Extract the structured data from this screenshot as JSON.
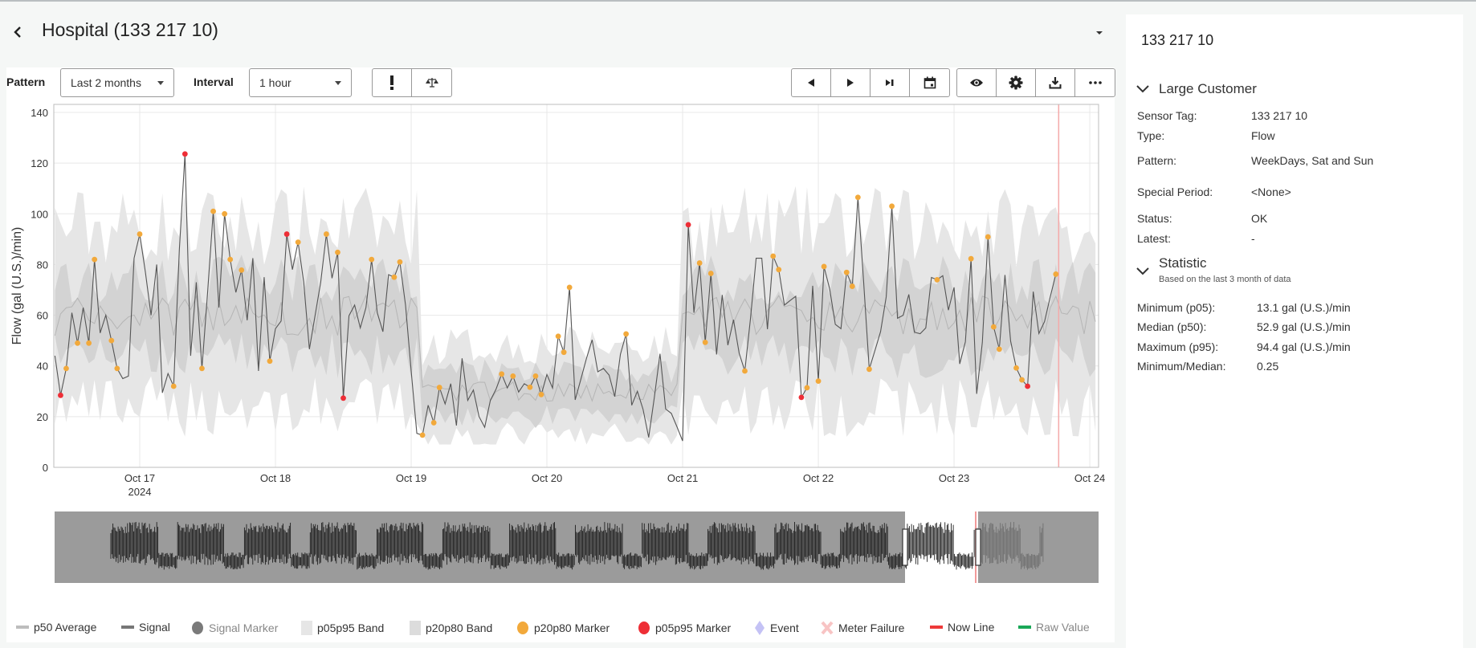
{
  "header": {
    "title": "Hospital (133 217 10)",
    "back_icon": "chevron-left-icon"
  },
  "toolbar": {
    "pattern_label": "Pattern",
    "pattern_value": "Last 2 months",
    "interval_label": "Interval",
    "interval_value": "1 hour",
    "buttons_left": [
      "exclamation-icon",
      "scale-icon"
    ],
    "nav_buttons": [
      "previous-icon",
      "play-icon",
      "skip-end-icon",
      "calendar-icon"
    ],
    "view_buttons": [
      "eye-icon",
      "gear-icon",
      "download-icon",
      "more-icon"
    ]
  },
  "legend": [
    {
      "label": "p50 Average",
      "color": "#bdbdbd",
      "shape": "line",
      "muted": false
    },
    {
      "label": "Signal",
      "color": "#777777",
      "shape": "line",
      "muted": false
    },
    {
      "label": "Signal Marker",
      "color": "#7a7a7a",
      "shape": "circle",
      "muted": true
    },
    {
      "label": "p05p95 Band",
      "color": "#e6e6e6",
      "shape": "square",
      "muted": false
    },
    {
      "label": "p20p80 Band",
      "color": "#dcdcdc",
      "shape": "square",
      "muted": false
    },
    {
      "label": "p20p80 Marker",
      "color": "#f2a93b",
      "shape": "circle",
      "muted": false
    },
    {
      "label": "p05p95 Marker",
      "color": "#ee2e36",
      "shape": "circle",
      "muted": false
    },
    {
      "label": "Event",
      "color": "#c4c2f5",
      "shape": "diamond",
      "muted": false
    },
    {
      "label": "Meter Failure",
      "color": "#f8c4c4",
      "shape": "cross",
      "muted": false
    },
    {
      "label": "Now Line",
      "color": "#ee3a3a",
      "shape": "line",
      "muted": false
    },
    {
      "label": "Raw Value",
      "color": "#1aa858",
      "shape": "line",
      "muted": true
    }
  ],
  "panel": {
    "title": "133 217 10",
    "section_title": "Large Customer",
    "fields": [
      {
        "label": "Sensor Tag:",
        "value": "133 217 10"
      },
      {
        "label": "Type:",
        "value": "Flow"
      },
      {
        "label": "Pattern:",
        "value": "WeekDays, Sat and Sun"
      },
      {
        "label": "Special Period:",
        "value": "<None>"
      },
      {
        "label": "Status:",
        "value": "OK"
      },
      {
        "label": "Latest:",
        "value": "-"
      }
    ],
    "statistic_title": "Statistic",
    "statistic_subtitle": "Based on the last 3 month of data",
    "stats": [
      {
        "label": "Minimum (p05):",
        "value": "13.1 gal (U.S.)/min"
      },
      {
        "label": "Median (p50):",
        "value": "52.9 gal (U.S.)/min"
      },
      {
        "label": "Maximum (p95):",
        "value": "94.4 gal (U.S.)/min"
      },
      {
        "label": "Minimum/Median:",
        "value": "0.25"
      }
    ]
  },
  "chart_data": {
    "type": "line",
    "ylabel": "Flow (gal (U.S.)/min)",
    "ylim": [
      0,
      140
    ],
    "yticks": [
      0,
      20,
      40,
      60,
      80,
      100,
      120,
      140
    ],
    "xlim": [
      "2024-10-16 09:00",
      "2024-10-24 01:00"
    ],
    "xticks": [
      {
        "date": "2024-10-17",
        "label": "Oct 17",
        "sublabel": "2024"
      },
      {
        "date": "2024-10-18",
        "label": "Oct 18"
      },
      {
        "date": "2024-10-19",
        "label": "Oct 19"
      },
      {
        "date": "2024-10-20",
        "label": "Oct 20"
      },
      {
        "date": "2024-10-21",
        "label": "Oct 21"
      },
      {
        "date": "2024-10-22",
        "label": "Oct 22"
      },
      {
        "date": "2024-10-23",
        "label": "Oct 23"
      },
      {
        "date": "2024-10-24",
        "label": "Oct 24"
      }
    ],
    "grid": true,
    "now_line": "2024-10-23 18:30",
    "signal_start": "2024-10-16 09:00",
    "signal_interval_hours": 1,
    "signal": [
      44,
      [
        28.4,
        "r"
      ],
      [
        39,
        "o"
      ],
      61,
      [
        49,
        "o"
      ],
      63,
      [
        49,
        "o"
      ],
      [
        82,
        "o"
      ],
      53,
      60,
      [
        50,
        "o"
      ],
      [
        39,
        "o"
      ],
      35,
      36,
      82.5,
      [
        92,
        "o"
      ],
      77,
      60,
      80,
      29.4,
      37,
      [
        32,
        "o"
      ],
      85.7,
      [
        123.6,
        "r"
      ],
      44,
      73,
      [
        39,
        "o"
      ],
      69,
      [
        101,
        "o"
      ],
      63,
      [
        100,
        "o"
      ],
      [
        82,
        "o"
      ],
      69,
      [
        77.8,
        "o"
      ],
      58,
      82.5,
      38,
      75,
      [
        41.9,
        "o"
      ],
      54.7,
      57.7,
      [
        92,
        "r"
      ],
      78,
      [
        88.8,
        "o"
      ],
      73,
      46.6,
      59.8,
      73,
      [
        92,
        "o"
      ],
      74.6,
      [
        84.8,
        "o"
      ],
      [
        27.3,
        "r"
      ],
      59.8,
      64,
      55,
      63,
      [
        82,
        "o"
      ],
      61,
      53.5,
      76,
      [
        75,
        "o"
      ],
      [
        81,
        "o"
      ],
      64,
      38,
      13.4,
      [
        12.7,
        "o"
      ],
      24.5,
      [
        17.6,
        "o"
      ],
      [
        31.5,
        "o"
      ],
      25,
      33,
      16.5,
      43,
      26.4,
      30.5,
      20,
      15.8,
      26.4,
      30.8,
      [
        36.8,
        "o"
      ],
      31.3,
      [
        36,
        "o"
      ],
      29.7,
      33,
      [
        31.6,
        "o"
      ],
      [
        36,
        "o"
      ],
      [
        28.7,
        "o"
      ],
      36.6,
      31.3,
      [
        51.7,
        "o"
      ],
      [
        45.4,
        "o"
      ],
      [
        71,
        "o"
      ],
      26.6,
      34.7,
      43,
      50.3,
      37.7,
      39,
      36.4,
      27.9,
      44.6,
      [
        52.6,
        "o"
      ],
      24.5,
      30,
      22.9,
      11.8,
      27.6,
      44.8,
      23,
      21.3,
      16,
      10.4,
      [
        95.7,
        "r"
      ],
      61,
      [
        80.6,
        "o"
      ],
      [
        49.3,
        "o"
      ],
      [
        76.5,
        "o"
      ],
      44.5,
      68,
      48.2,
      58.2,
      45,
      [
        38,
        "o"
      ],
      58.7,
      82.5,
      82.5,
      54.5,
      [
        83.3,
        "o"
      ],
      [
        78,
        "o"
      ],
      64,
      65.8,
      67.5,
      [
        27.6,
        "r"
      ],
      [
        31.4,
        "o"
      ],
      71.6,
      [
        34,
        "o"
      ],
      [
        79.2,
        "o"
      ],
      70.4,
      56.4,
      54.7,
      [
        76.9,
        "o"
      ],
      [
        71.4,
        "o"
      ],
      [
        106.5,
        "o"
      ],
      73.5,
      [
        38.7,
        "o"
      ],
      46,
      53.5,
      67.2,
      [
        103,
        "o"
      ],
      58.8,
      60,
      68.2,
      53.3,
      52.7,
      55,
      74.9,
      [
        74,
        "o"
      ],
      75.6,
      62,
      71,
      40.8,
      49.5,
      [
        82.3,
        "o"
      ],
      29,
      49.3,
      [
        90.9,
        "o"
      ],
      [
        55.4,
        "o"
      ],
      [
        46.6,
        "o"
      ],
      75.9,
      49.8,
      [
        39.2,
        "o"
      ],
      [
        34.5,
        "o"
      ],
      [
        32,
        "r"
      ],
      69.3,
      52.8,
      57.5,
      67.2,
      [
        76.2,
        "o"
      ]
    ],
    "marker_codes": {
      "o": "p20p80 Marker",
      "r": "p05p95 Marker"
    },
    "pattern_bands": [
      {
        "from": "2024-10-16 09:00",
        "to": "2024-10-19 02:00",
        "p05": 24,
        "p20": 44,
        "p50": 60,
        "p80": 74,
        "p95": 95
      },
      {
        "from": "2024-10-19 02:00",
        "to": "2024-10-21 00:00",
        "p05": 12,
        "p20": 20,
        "p50": 30,
        "p80": 38,
        "p95": 48
      },
      {
        "from": "2024-10-21 00:00",
        "to": "2024-10-24 01:00",
        "p05": 24,
        "p20": 44,
        "p50": 60,
        "p80": 74,
        "p95": 95
      }
    ],
    "colors": {
      "signal": "#555555",
      "p50": "#b5b5b5",
      "p05p95": "#e6e6e6",
      "p20p80": "#d3d3d3",
      "p20p80_marker": "#f2a93b",
      "p05p95_marker": "#ee2e36",
      "now_line": "#f4a9a9"
    }
  },
  "navigator": {
    "background": "#9b9b9b"
  }
}
